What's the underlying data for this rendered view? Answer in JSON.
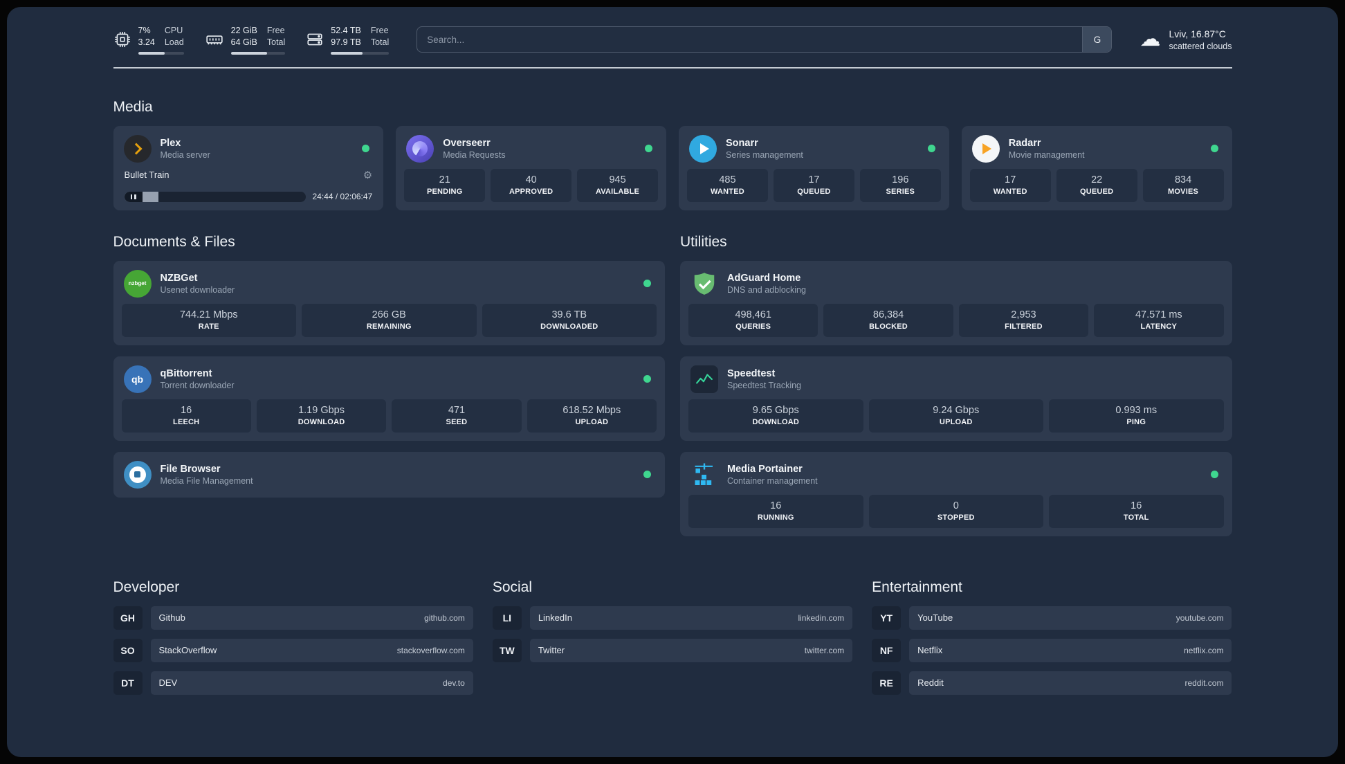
{
  "topbar": {
    "resources": [
      {
        "name": "cpu",
        "value_top": "7%",
        "value_bottom": "3.24",
        "label_top": "CPU",
        "label_bottom": "Load",
        "progress": 58
      },
      {
        "name": "memory",
        "value_top": "22 GiB",
        "value_bottom": "64 GiB",
        "label_top": "Free",
        "label_bottom": "Total",
        "progress": 66
      },
      {
        "name": "disk",
        "value_top": "52.4 TB",
        "value_bottom": "97.9 TB",
        "label_top": "Free",
        "label_bottom": "Total",
        "progress": 55
      }
    ],
    "search": {
      "placeholder": "Search...",
      "button": "G"
    },
    "weather": {
      "location": "Lviv, 16.87°C",
      "condition": "scattered clouds"
    }
  },
  "media": {
    "title": "Media",
    "plex": {
      "name": "Plex",
      "desc": "Media server",
      "now_playing": {
        "title": "Bullet Train",
        "time": "24:44 / 02:06:47",
        "progress": 19
      }
    },
    "overseerr": {
      "name": "Overseerr",
      "desc": "Media Requests",
      "stats": [
        {
          "value": "21",
          "label": "PENDING"
        },
        {
          "value": "40",
          "label": "APPROVED"
        },
        {
          "value": "945",
          "label": "AVAILABLE"
        }
      ]
    },
    "sonarr": {
      "name": "Sonarr",
      "desc": "Series management",
      "stats": [
        {
          "value": "485",
          "label": "WANTED"
        },
        {
          "value": "17",
          "label": "QUEUED"
        },
        {
          "value": "196",
          "label": "SERIES"
        }
      ]
    },
    "radarr": {
      "name": "Radarr",
      "desc": "Movie management",
      "stats": [
        {
          "value": "17",
          "label": "WANTED"
        },
        {
          "value": "22",
          "label": "QUEUED"
        },
        {
          "value": "834",
          "label": "MOVIES"
        }
      ]
    }
  },
  "documents": {
    "title": "Documents & Files",
    "nzbget": {
      "name": "NZBGet",
      "desc": "Usenet downloader",
      "icon_label": "nzbget",
      "stats": [
        {
          "value": "744.21 Mbps",
          "label": "RATE"
        },
        {
          "value": "266 GB",
          "label": "REMAINING"
        },
        {
          "value": "39.6 TB",
          "label": "DOWNLOADED"
        }
      ]
    },
    "qbittorrent": {
      "name": "qBittorrent",
      "desc": "Torrent downloader",
      "icon_label": "qb",
      "stats": [
        {
          "value": "16",
          "label": "LEECH"
        },
        {
          "value": "1.19 Gbps",
          "label": "DOWNLOAD"
        },
        {
          "value": "471",
          "label": "SEED"
        },
        {
          "value": "618.52 Mbps",
          "label": "UPLOAD"
        }
      ]
    },
    "filebrowser": {
      "name": "File Browser",
      "desc": "Media File Management"
    }
  },
  "utilities": {
    "title": "Utilities",
    "adguard": {
      "name": "AdGuard Home",
      "desc": "DNS and adblocking",
      "stats": [
        {
          "value": "498,461",
          "label": "QUERIES"
        },
        {
          "value": "86,384",
          "label": "BLOCKED"
        },
        {
          "value": "2,953",
          "label": "FILTERED"
        },
        {
          "value": "47.571 ms",
          "label": "LATENCY"
        }
      ]
    },
    "speedtest": {
      "name": "Speedtest",
      "desc": "Speedtest Tracking",
      "stats": [
        {
          "value": "9.65 Gbps",
          "label": "DOWNLOAD"
        },
        {
          "value": "9.24 Gbps",
          "label": "UPLOAD"
        },
        {
          "value": "0.993 ms",
          "label": "PING"
        }
      ]
    },
    "portainer": {
      "name": "Media Portainer",
      "desc": "Container management",
      "stats": [
        {
          "value": "16",
          "label": "RUNNING"
        },
        {
          "value": "0",
          "label": "STOPPED"
        },
        {
          "value": "16",
          "label": "TOTAL"
        }
      ]
    }
  },
  "bookmarks": {
    "developer": {
      "title": "Developer",
      "items": [
        {
          "abbr": "GH",
          "name": "Github",
          "url": "github.com"
        },
        {
          "abbr": "SO",
          "name": "StackOverflow",
          "url": "stackoverflow.com"
        },
        {
          "abbr": "DT",
          "name": "DEV",
          "url": "dev.to"
        }
      ]
    },
    "social": {
      "title": "Social",
      "items": [
        {
          "abbr": "LI",
          "name": "LinkedIn",
          "url": "linkedin.com"
        },
        {
          "abbr": "TW",
          "name": "Twitter",
          "url": "twitter.com"
        }
      ]
    },
    "entertainment": {
      "title": "Entertainment",
      "items": [
        {
          "abbr": "YT",
          "name": "YouTube",
          "url": "youtube.com"
        },
        {
          "abbr": "NF",
          "name": "Netflix",
          "url": "netflix.com"
        },
        {
          "abbr": "RE",
          "name": "Reddit",
          "url": "reddit.com"
        }
      ]
    }
  },
  "colors": {
    "background": "#202c3f",
    "card": "#2e3a4e",
    "stat_block": "#232f42",
    "status_online": "#3fd68f",
    "plex_accent": "#e5a00d"
  }
}
